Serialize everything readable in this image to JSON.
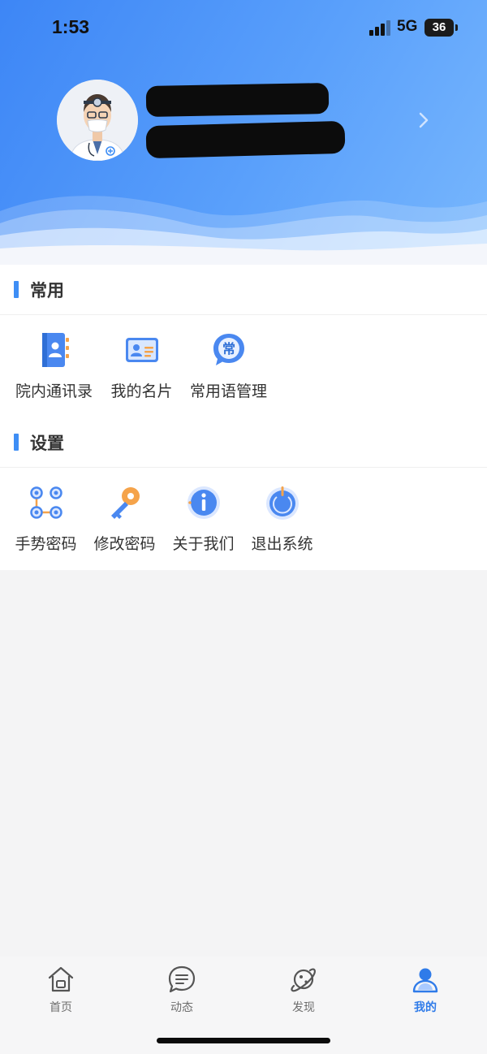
{
  "status_bar": {
    "time": "1:53",
    "network": "5G",
    "battery": "36"
  },
  "profile": {
    "name": "",
    "subtitle": ""
  },
  "sections": {
    "common": {
      "title": "常用",
      "items": [
        {
          "label": "院内通讯录",
          "icon": "contacts-book-icon"
        },
        {
          "label": "我的名片",
          "icon": "business-card-icon"
        },
        {
          "label": "常用语管理",
          "icon": "common-phrases-icon"
        }
      ]
    },
    "settings": {
      "title": "设置",
      "items": [
        {
          "label": "手势密码",
          "icon": "gesture-pattern-icon"
        },
        {
          "label": "修改密码",
          "icon": "key-icon"
        },
        {
          "label": "关于我们",
          "icon": "info-icon"
        },
        {
          "label": "退出系统",
          "icon": "power-icon"
        }
      ]
    }
  },
  "tabbar": {
    "tabs": [
      {
        "label": "首页",
        "icon": "home-icon"
      },
      {
        "label": "动态",
        "icon": "message-bubble-icon"
      },
      {
        "label": "发现",
        "icon": "planet-icon"
      },
      {
        "label": "我的",
        "icon": "user-icon",
        "active": true
      }
    ]
  },
  "colors": {
    "accent": "#3e8ef5",
    "active_tab": "#2f7be9",
    "header_start": "#3d86f6",
    "header_end": "#78b7fd"
  }
}
